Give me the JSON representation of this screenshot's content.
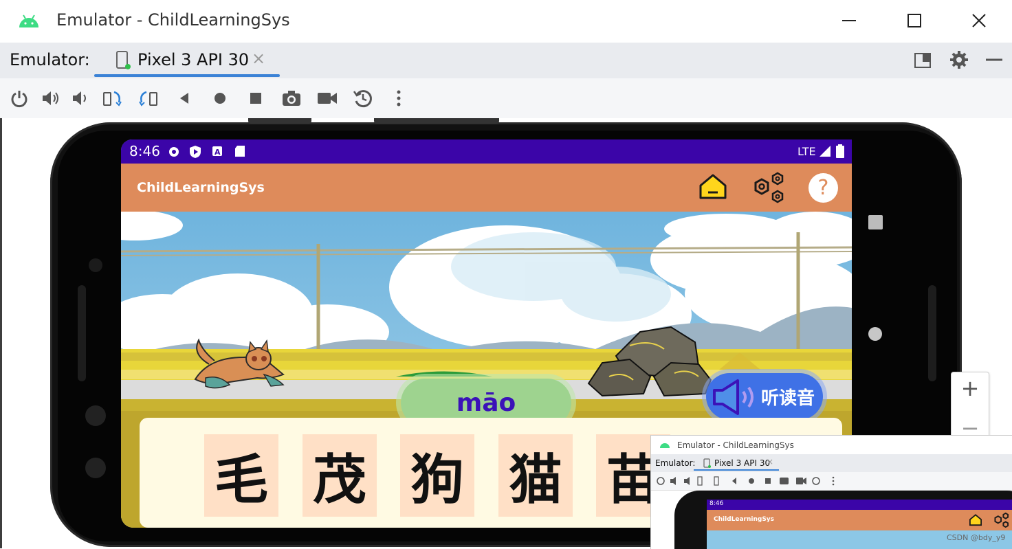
{
  "window": {
    "title": "Emulator - ChildLearningSys",
    "controls": [
      "minimize",
      "maximize",
      "close"
    ]
  },
  "tabbar": {
    "label": "Emulator:",
    "device_tab": "Pixel 3 API 30",
    "close_glyph": "×"
  },
  "toolbar": {
    "icons": [
      "power-icon",
      "volume-up-icon",
      "volume-down-icon",
      "rotate-left-icon",
      "rotate-right-icon",
      "back-icon",
      "home-icon",
      "overview-icon",
      "screenshot-icon",
      "screen-record-icon",
      "snapshot-icon",
      "more-icon"
    ]
  },
  "device": {
    "status": {
      "time": "8:46",
      "network": "LTE"
    },
    "app": {
      "title": "ChildLearningSys",
      "actions": [
        "home-icon",
        "settings-hex-icon",
        "help-icon"
      ],
      "help_glyph": "?"
    },
    "game": {
      "pinyin": "māo",
      "listen_label": "听读音",
      "cards": [
        "毛",
        "茂",
        "狗",
        "猫",
        "苗"
      ]
    }
  },
  "zoom": {
    "plus": "+",
    "minus": "−"
  },
  "mini": {
    "title": "Emulator - ChildLearningSys",
    "label": "Emulator:",
    "device_tab": "Pixel 3 API 30",
    "time": "8:46",
    "app_title": "ChildLearningSys"
  },
  "watermark": "CSDN @bdy_y9",
  "colors": {
    "statusbar": "#3b05a8",
    "appbar": "#de8b5b",
    "accent_tab": "#3b82d6",
    "pinyin_pill": "#9ed38f",
    "listen_button": "#3f71e6",
    "card_bg": "#ffe0c6"
  }
}
